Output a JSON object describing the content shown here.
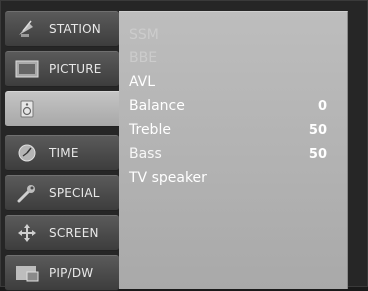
{
  "sidebar": {
    "items": [
      {
        "label": "STATION",
        "icon": "satellite-dish-icon"
      },
      {
        "label": "PICTURE",
        "icon": "picture-frame-icon"
      },
      {
        "label": "",
        "icon": "speaker-icon",
        "active": true
      },
      {
        "label": "TIME",
        "icon": "clock-icon"
      },
      {
        "label": "SPECIAL",
        "icon": "wrench-icon"
      },
      {
        "label": "SCREEN",
        "icon": "move-arrows-icon"
      },
      {
        "label": "PIP/DW",
        "icon": "pip-screen-icon"
      }
    ]
  },
  "audio_menu": {
    "items": [
      {
        "label": "SSM",
        "value": "",
        "dim": true
      },
      {
        "label": "BBE",
        "value": "",
        "dim": true
      },
      {
        "label": "AVL",
        "value": ""
      },
      {
        "label": "Balance",
        "value": "0"
      },
      {
        "label": "Treble",
        "value": "50"
      },
      {
        "label": "Bass",
        "value": "50",
        "dim": true
      },
      {
        "label": "TV speaker",
        "value": ""
      }
    ]
  },
  "colors": {
    "panel": "#b3b3b3",
    "sidebar_item": "#4a4a4a",
    "text": "#ffffff"
  }
}
